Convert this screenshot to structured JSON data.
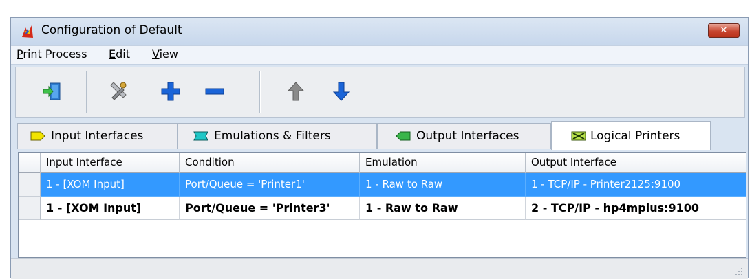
{
  "window": {
    "title": "Configuration of Default",
    "close_label": "✕"
  },
  "menu": [
    "Print Process",
    "Edit",
    "View"
  ],
  "toolbar": {
    "buttons": [
      {
        "name": "exit-button",
        "icon": "exit-icon"
      },
      {
        "name": "properties-button",
        "icon": "wrench-icon"
      },
      {
        "name": "add-button",
        "icon": "plus-icon"
      },
      {
        "name": "remove-button",
        "icon": "minus-icon"
      },
      {
        "name": "move-up-button",
        "icon": "arrow-up-icon"
      },
      {
        "name": "move-down-button",
        "icon": "arrow-down-icon"
      }
    ]
  },
  "tabs": [
    {
      "label": "Input Interfaces",
      "icon": "input-interface-icon",
      "color": "#f2e400"
    },
    {
      "label": "Emulations & Filters",
      "icon": "emulation-icon",
      "color": "#1fc7c7"
    },
    {
      "label": "Output Interfaces",
      "icon": "output-interface-icon",
      "color": "#39b54a"
    },
    {
      "label": "Logical Printers",
      "icon": "logical-printer-icon",
      "color": "#b7e04a",
      "active": true
    }
  ],
  "table": {
    "columns": [
      "Input Interface",
      "Condition",
      "Emulation",
      "Output Interface"
    ],
    "rows": [
      {
        "cells": [
          "1 - [XOM Input]",
          "Port/Queue = 'Printer1'",
          "1 - Raw to Raw",
          "1 - TCP/IP - Printer2125:9100"
        ],
        "selected": true
      },
      {
        "cells": [
          "1 - [XOM Input]",
          "Port/Queue = 'Printer3'",
          "1 - Raw to Raw",
          "2 - TCP/IP - hp4mplus:9100"
        ],
        "bold": true
      }
    ]
  },
  "colors": {
    "selection": "#3399ff",
    "add": "#1a64d8",
    "remove": "#1a64d8",
    "up": "#8a8a8a",
    "down": "#1a64d8"
  }
}
